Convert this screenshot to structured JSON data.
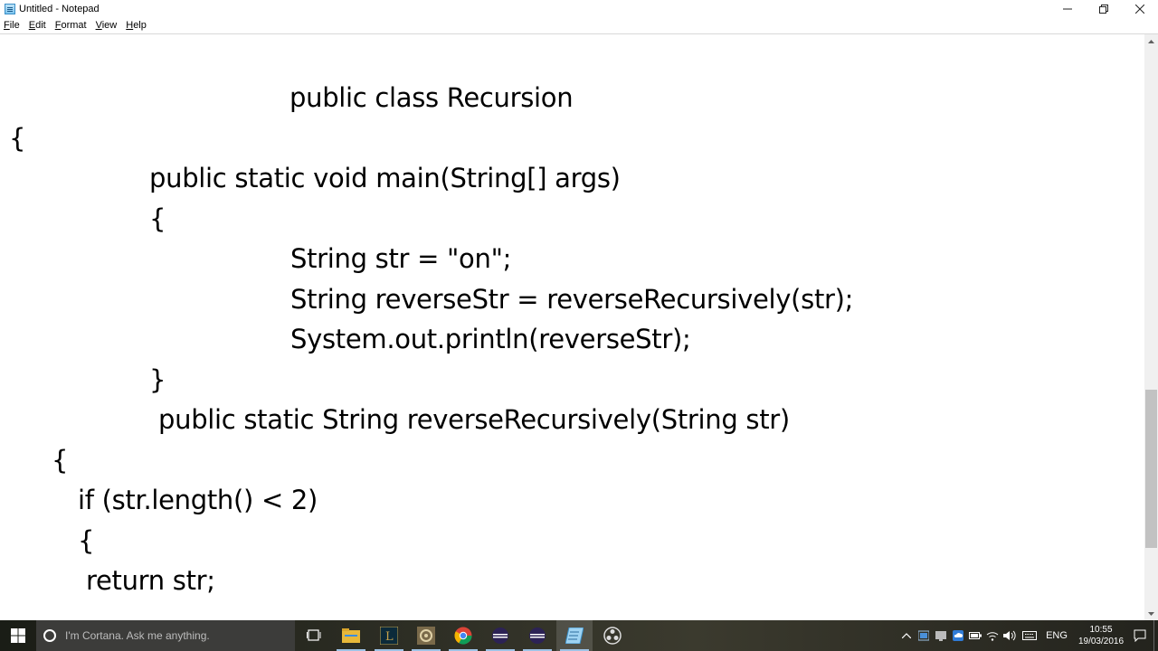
{
  "window": {
    "title": "Untitled - Notepad",
    "minimize_label": "–",
    "maximize_label": "❐",
    "close_label": "✕"
  },
  "menu": [
    {
      "label": "F",
      "rest": "ile"
    },
    {
      "label": "E",
      "rest": "dit"
    },
    {
      "label": "F",
      "rest": "ormat",
      "display": "Format"
    },
    {
      "label": "V",
      "rest": "iew"
    },
    {
      "label": "H",
      "rest": "elp"
    }
  ],
  "menu_labels": [
    "File",
    "Edit",
    "Format",
    "View",
    "Help"
  ],
  "editor": {
    "lines": [
      "public class Recursion",
      "{",
      "public static void main(String[] args)",
      "{",
      "String str = \"on\";",
      "String reverseStr = reverseRecursively(str);",
      "System.out.println(reverseStr);",
      "}",
      "public static String reverseRecursively(String str)",
      "{",
      "if (str.length() < 2)",
      "{",
      "return str;"
    ]
  },
  "taskbar": {
    "search_placeholder": "I'm Cortana. Ask me anything.",
    "apps": [
      "task-view",
      "file-explorer",
      "league-of-legends",
      "app-gear",
      "chrome",
      "eclipse",
      "eclipse-2",
      "notepad",
      "obs"
    ],
    "language": "ENG",
    "time": "10:55",
    "date": "19/03/2016"
  },
  "colors": {
    "taskbar_bg": "#2a2b22",
    "cortana_bg": "#3c3c3a",
    "text": "#000000",
    "scroll_thumb": "#c2c2c2"
  }
}
